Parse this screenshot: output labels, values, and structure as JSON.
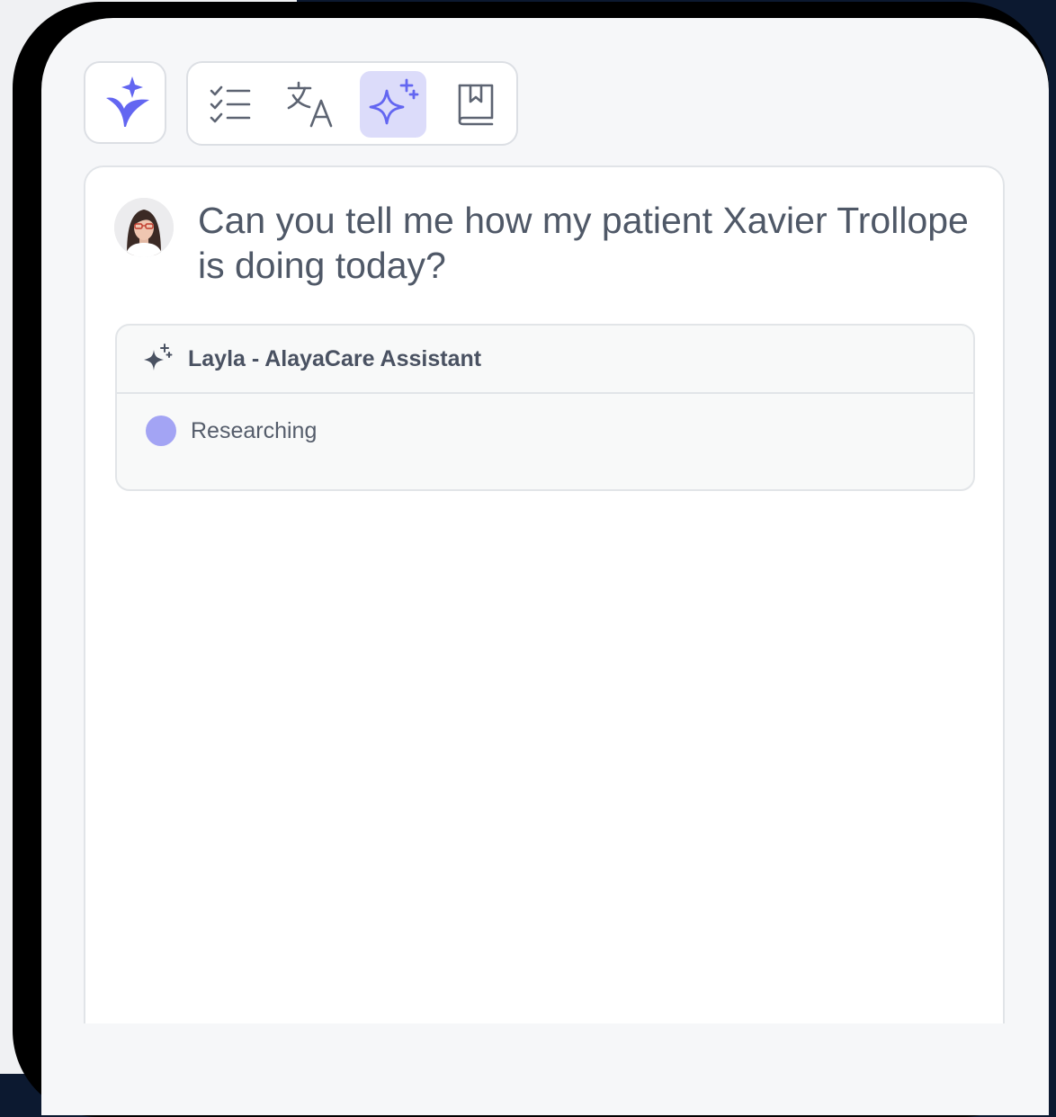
{
  "app": {
    "logo_icon": "sprout-sparkle-icon",
    "accent_color": "#6366f1"
  },
  "toolbar": {
    "tools": [
      {
        "icon": "checklist-icon",
        "active": false
      },
      {
        "icon": "translate-icon",
        "active": false
      },
      {
        "icon": "sparkle-icon",
        "active": true
      },
      {
        "icon": "bookmark-book-icon",
        "active": false
      }
    ]
  },
  "conversation": {
    "user_avatar": "avatar",
    "question": "Can you tell me how my patient Xavier Trollope is doing today?",
    "assistant": {
      "icon": "sparkle-icon",
      "name": "Layla - AlayaCare Assistant",
      "status": "Researching",
      "status_color": "#a3a4f4"
    }
  }
}
